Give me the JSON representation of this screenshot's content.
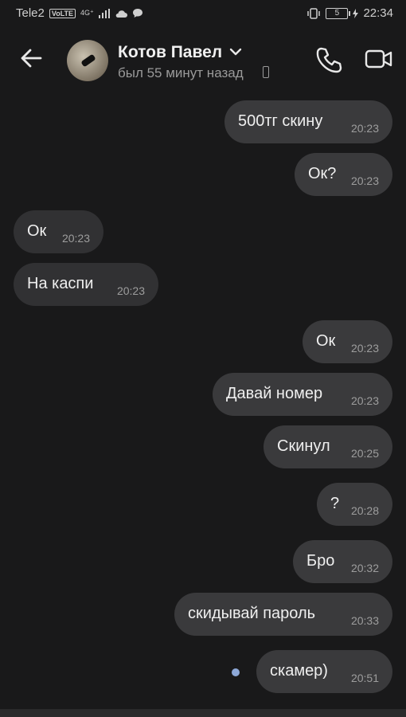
{
  "status_bar": {
    "carrier": "Tele2",
    "volte": "VoLTE",
    "network": "4G⁺",
    "battery": "5",
    "time": "22:34"
  },
  "header": {
    "contact_name": "Котов Павел",
    "last_seen": "был 55 минут назад"
  },
  "messages": [
    {
      "text": "500тг скину",
      "time": "20:23",
      "direction": "out"
    },
    {
      "text": "Ок?",
      "time": "20:23",
      "direction": "out"
    },
    {
      "text": "Ок",
      "time": "20:23",
      "direction": "in"
    },
    {
      "text": "На каспи",
      "time": "20:23",
      "direction": "in"
    },
    {
      "text": "Ок",
      "time": "20:23",
      "direction": "out"
    },
    {
      "text": "Давай номер",
      "time": "20:23",
      "direction": "out"
    },
    {
      "text": "Скинул",
      "time": "20:25",
      "direction": "out"
    },
    {
      "text": "?",
      "time": "20:28",
      "direction": "out"
    },
    {
      "text": "Бро",
      "time": "20:32",
      "direction": "out"
    },
    {
      "text": "скидывай пароль",
      "time": "20:33",
      "direction": "out"
    },
    {
      "text": "скамер)",
      "time": "20:51",
      "direction": "out",
      "unread": true
    }
  ]
}
